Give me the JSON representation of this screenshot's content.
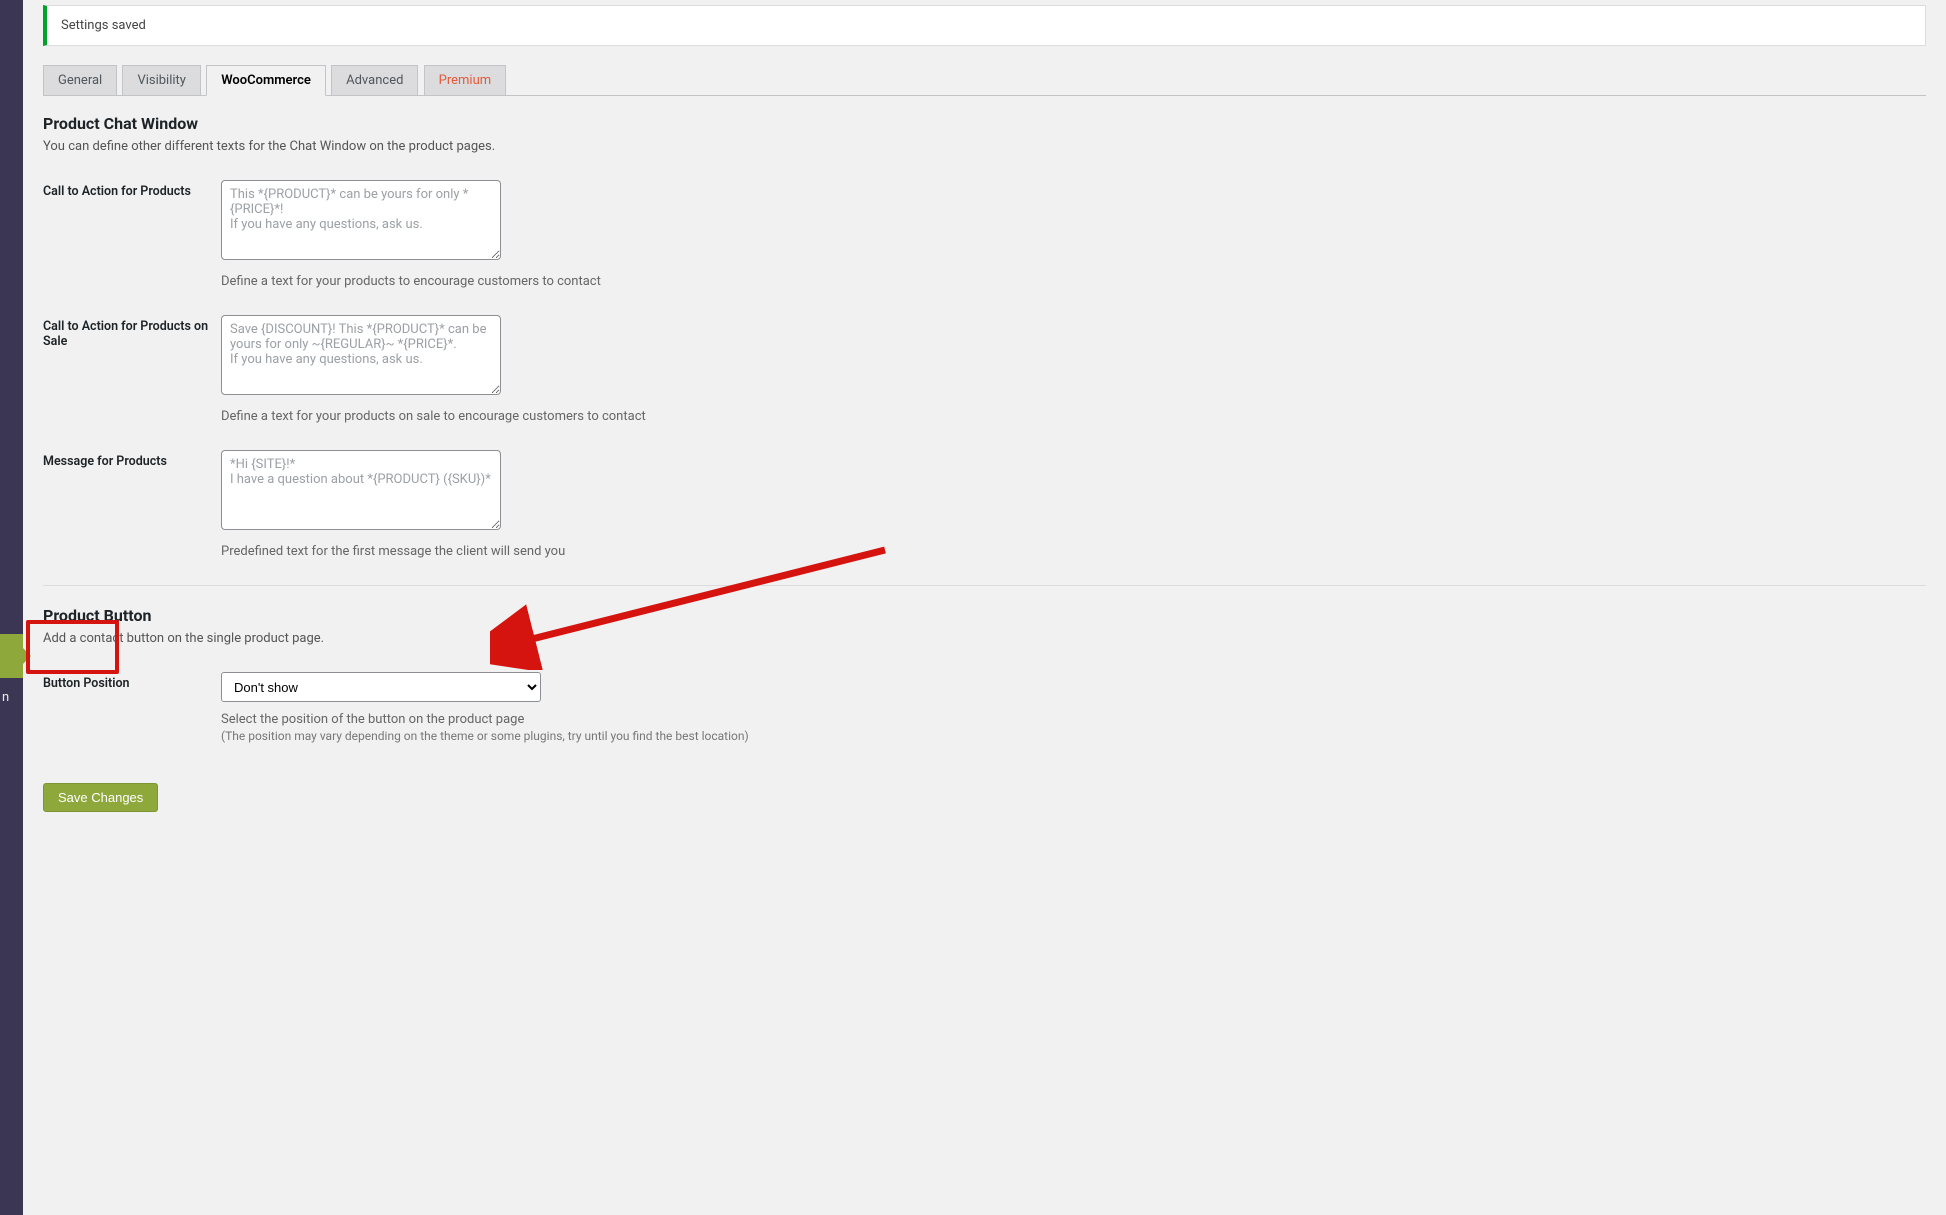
{
  "sidebar": {
    "fragment_text": "n"
  },
  "notice": {
    "text": "Settings saved"
  },
  "tabs": [
    {
      "label": "General"
    },
    {
      "label": "Visibility"
    },
    {
      "label": "WooCommerce"
    },
    {
      "label": "Advanced"
    },
    {
      "label": "Premium"
    }
  ],
  "sections": {
    "chat_window": {
      "title": "Product Chat Window",
      "desc": "You can define other different texts for the Chat Window on the product pages."
    },
    "product_button": {
      "title": "Product Button",
      "desc": "Add a contact button on the single product page."
    }
  },
  "fields": {
    "cta_products": {
      "label": "Call to Action for Products",
      "placeholder": "This *{PRODUCT}* can be yours for only *{PRICE}*!\nIf you have any questions, ask us.",
      "help": "Define a text for your products to encourage customers to contact"
    },
    "cta_sale": {
      "label": "Call to Action for Products on Sale",
      "placeholder": "Save {DISCOUNT}! This *{PRODUCT}* can be yours for only ~{REGULAR}~ *{PRICE}*.\nIf you have any questions, ask us.",
      "help": "Define a text for your products on sale to encourage customers to contact"
    },
    "msg_products": {
      "label": "Message for Products",
      "placeholder": "*Hi {SITE}!*\nI have a question about *{PRODUCT} ({SKU})*",
      "help": "Predefined text for the first message the client will send you"
    },
    "button_position": {
      "label": "Button Position",
      "selected": "Don't show",
      "help": "Select the position of the button on the product page",
      "help_sub": "(The position may vary depending on the theme or some plugins, try until you find the best location)"
    }
  },
  "buttons": {
    "save": "Save Changes"
  }
}
